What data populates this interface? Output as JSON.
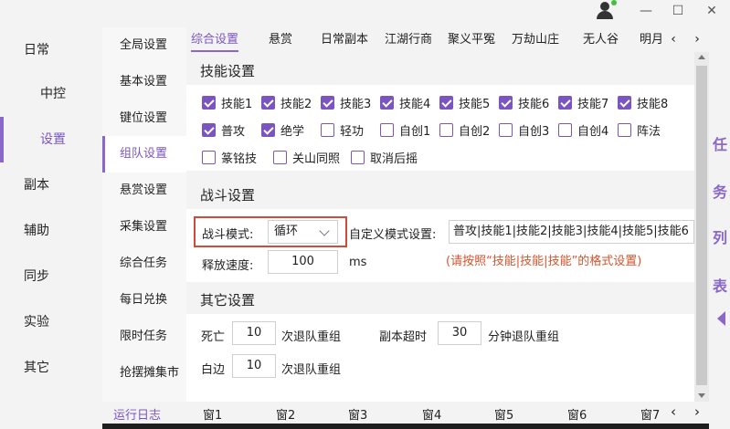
{
  "window": {
    "minimize": "—",
    "maximize": "☐",
    "close": "✕"
  },
  "nav_primary": [
    "日常",
    "中控",
    "设置",
    "副本",
    "辅助",
    "同步",
    "实验",
    "其它"
  ],
  "nav_secondary": [
    "全局设置",
    "基本设置",
    "键位设置",
    "组队设置",
    "悬赏设置",
    "采集设置",
    "综合任务",
    "每日兑换",
    "限时任务",
    "抢摆摊集市"
  ],
  "tabs": [
    "综合设置",
    "悬赏",
    "日常副本",
    "江湖行商",
    "聚义平冤",
    "万劫山庄",
    "无人谷",
    "明月"
  ],
  "skills": {
    "title": "技能设置",
    "options": [
      {
        "label": "技能1",
        "checked": true
      },
      {
        "label": "技能2",
        "checked": true
      },
      {
        "label": "技能3",
        "checked": true
      },
      {
        "label": "技能4",
        "checked": true
      },
      {
        "label": "技能5",
        "checked": true
      },
      {
        "label": "技能6",
        "checked": true
      },
      {
        "label": "技能7",
        "checked": true
      },
      {
        "label": "技能8",
        "checked": true
      },
      {
        "label": "普攻",
        "checked": true
      },
      {
        "label": "绝学",
        "checked": true
      },
      {
        "label": "轻功",
        "checked": false
      },
      {
        "label": "自创1",
        "checked": false
      },
      {
        "label": "自创2",
        "checked": false
      },
      {
        "label": "自创3",
        "checked": false
      },
      {
        "label": "自创4",
        "checked": false
      },
      {
        "label": "阵法",
        "checked": false
      },
      {
        "label": "篆铭技",
        "checked": false
      },
      {
        "label": "关山同照",
        "checked": false
      },
      {
        "label": "取消后摇",
        "checked": false
      }
    ]
  },
  "combat": {
    "title": "战斗设置",
    "mode_label": "战斗模式:",
    "mode_value": "循环",
    "custom_label": "自定义模式设置:",
    "custom_value": "普攻|技能1|技能2|技能3|技能4|技能5|技能6",
    "hint": "(请按照“技能|技能|技能”的格式设置)",
    "speed_label": "释放速度:",
    "speed_value": "100",
    "speed_unit": "ms"
  },
  "other": {
    "title": "其它设置",
    "death_label": "死亡",
    "death_value": "10",
    "death_suffix": "次退队重组",
    "timeout_label": "副本超时",
    "timeout_value": "30",
    "timeout_suffix": "分钟退队重组",
    "white_label": "白边",
    "white_value": "10",
    "white_suffix": "次退队重组"
  },
  "side_task": [
    "任",
    "务",
    "列",
    "表"
  ],
  "bottom_tabs": [
    "运行日志",
    "窗1",
    "窗2",
    "窗3",
    "窗4",
    "窗5",
    "窗6",
    "窗7"
  ],
  "colors": {
    "accent": "#8a67c8",
    "highlight_border": "#d24a3a",
    "hint": "#d9532c"
  }
}
